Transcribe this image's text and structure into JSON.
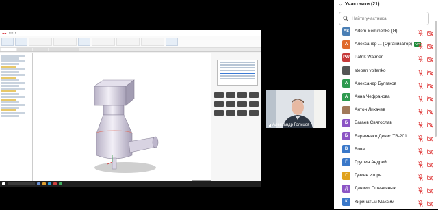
{
  "panel": {
    "title": "Участники (21)",
    "search_placeholder": "Найти участника"
  },
  "video": {
    "name": "Александр Гольцов"
  },
  "participants": [
    {
      "initials": "AS",
      "color": "#4a7fb5",
      "name": "Artem Seminenko (Я)",
      "tag": ""
    },
    {
      "initials": "А",
      "color": "#e06b2d",
      "name": "Александр ... (Организатор)",
      "tag": "VR"
    },
    {
      "initials": "PW",
      "color": "#c63a3a",
      "name": "Patrik Watmen",
      "tag": ""
    },
    {
      "initials": "",
      "color": "#555555",
      "name": "stepan voitenko",
      "tag": ""
    },
    {
      "initials": "А",
      "color": "#2e9a4f",
      "name": "Александр Булгаков",
      "tag": ""
    },
    {
      "initials": "А",
      "color": "#2e9a4f",
      "name": "Анна Чефранова",
      "tag": ""
    },
    {
      "initials": "",
      "color": "#a27a5a",
      "name": "Антон Лихачев",
      "tag": ""
    },
    {
      "initials": "Б",
      "color": "#8c55c5",
      "name": "Багаев Святослав",
      "tag": ""
    },
    {
      "initials": "Б",
      "color": "#8c55c5",
      "name": "Бараменко Денис ТВ-201",
      "tag": ""
    },
    {
      "initials": "В",
      "color": "#3a78c9",
      "name": "Вова",
      "tag": ""
    },
    {
      "initials": "Г",
      "color": "#3a78c9",
      "name": "Грушин Андрей",
      "tag": ""
    },
    {
      "initials": "Г",
      "color": "#e0a21e",
      "name": "Гузиев Игорь",
      "tag": ""
    },
    {
      "initials": "Д",
      "color": "#8c55c5",
      "name": "Даниил Пшеничных",
      "tag": ""
    },
    {
      "initials": "К",
      "color": "#3a78c9",
      "name": "Киричатый Максим",
      "tag": ""
    }
  ],
  "icons": {
    "chevron": "chevron-down-icon",
    "search": "search-icon",
    "mic_off": "mic-off-icon",
    "cam_off": "camera-off-icon"
  }
}
